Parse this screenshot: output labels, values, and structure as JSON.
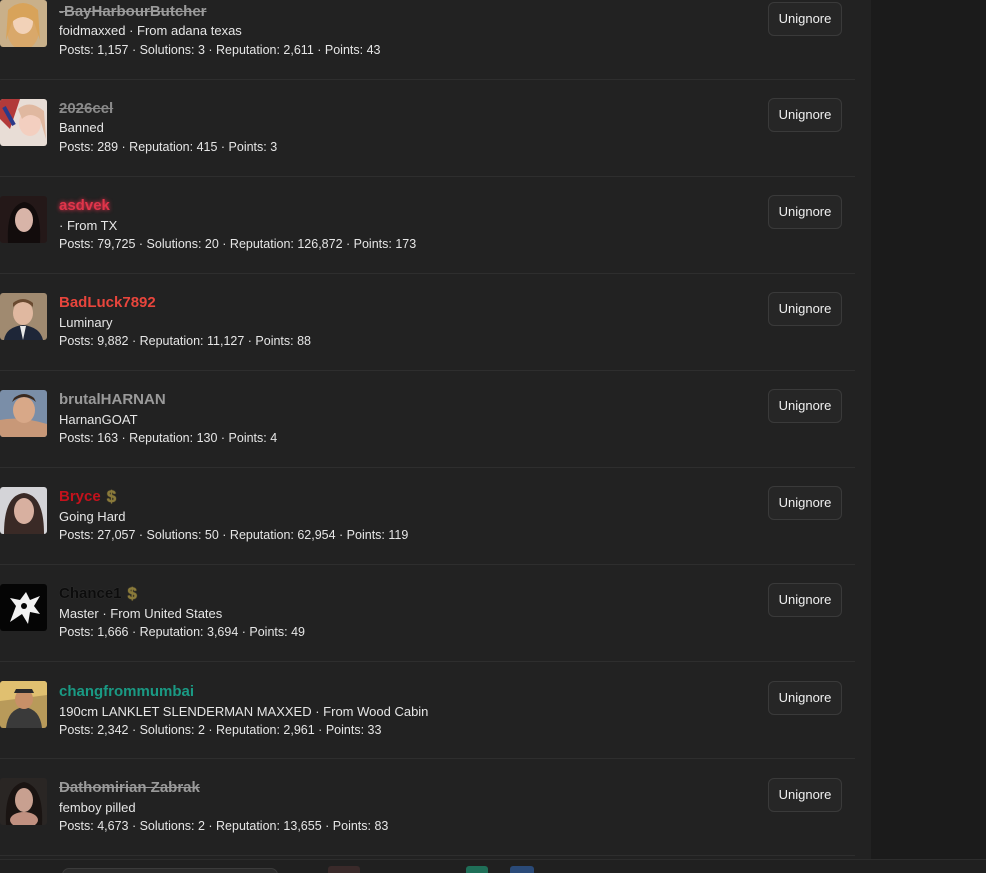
{
  "button_label": "Unignore",
  "users": [
    {
      "name": "-BayHarbourButcher",
      "title": "foidmaxxed · From adana texas",
      "stats": "Posts: 1,157 · Solutions: 3 · Reputation: 2,611 · Points: 43",
      "name_color": "#9a9a9a",
      "strikethrough": true
    },
    {
      "name": "2026cel",
      "title": "Banned",
      "stats": "Posts: 289 · Reputation: 415 · Points: 3",
      "name_color": "#8a8a8a",
      "strikethrough": true
    },
    {
      "name": "asdvek",
      "title": " · From TX",
      "stats": "Posts: 79,725 · Solutions: 20 · Reputation: 126,872 · Points: 173",
      "name_color": "#e0354a",
      "strikethrough": false
    },
    {
      "name": "BadLuck7892",
      "title": "Luminary",
      "stats": "Posts: 9,882 · Reputation: 11,127 · Points: 88",
      "name_color": "#e8453c",
      "strikethrough": false
    },
    {
      "name": "brutalHARNAN",
      "title": "HarnanGOAT",
      "stats": "Posts: 163 · Reputation: 130 · Points: 4",
      "name_color": "#9a9a9a",
      "strikethrough": false
    },
    {
      "name": "Bryce",
      "title": "Going Hard",
      "stats": "Posts: 27,057 · Solutions: 50 · Reputation: 62,954 · Points: 119",
      "name_color": "#c4121c",
      "strikethrough": false,
      "badge": "$"
    },
    {
      "name": "Chance1",
      "title": "Master · From United States",
      "stats": "Posts: 1,666 · Reputation: 3,694 · Points: 49",
      "name_color": "#0c0c0c",
      "strikethrough": false,
      "badge": "$"
    },
    {
      "name": "changfrommumbai",
      "title": "190cm LANKLET SLENDERMAN MAXXED · From Wood Cabin",
      "stats": "Posts: 2,342 · Solutions: 2 · Reputation: 2,961 · Points: 33",
      "name_color": "#1a9a84",
      "strikethrough": false
    },
    {
      "name": "Dathomirian Zabrak",
      "title": "femboy pilled",
      "stats": "Posts: 4,673 · Solutions: 2 · Reputation: 13,655 · Points: 83",
      "name_color": "#9a9a9a",
      "strikethrough": true
    }
  ],
  "icons": {
    "badge": "dollar-icon"
  }
}
